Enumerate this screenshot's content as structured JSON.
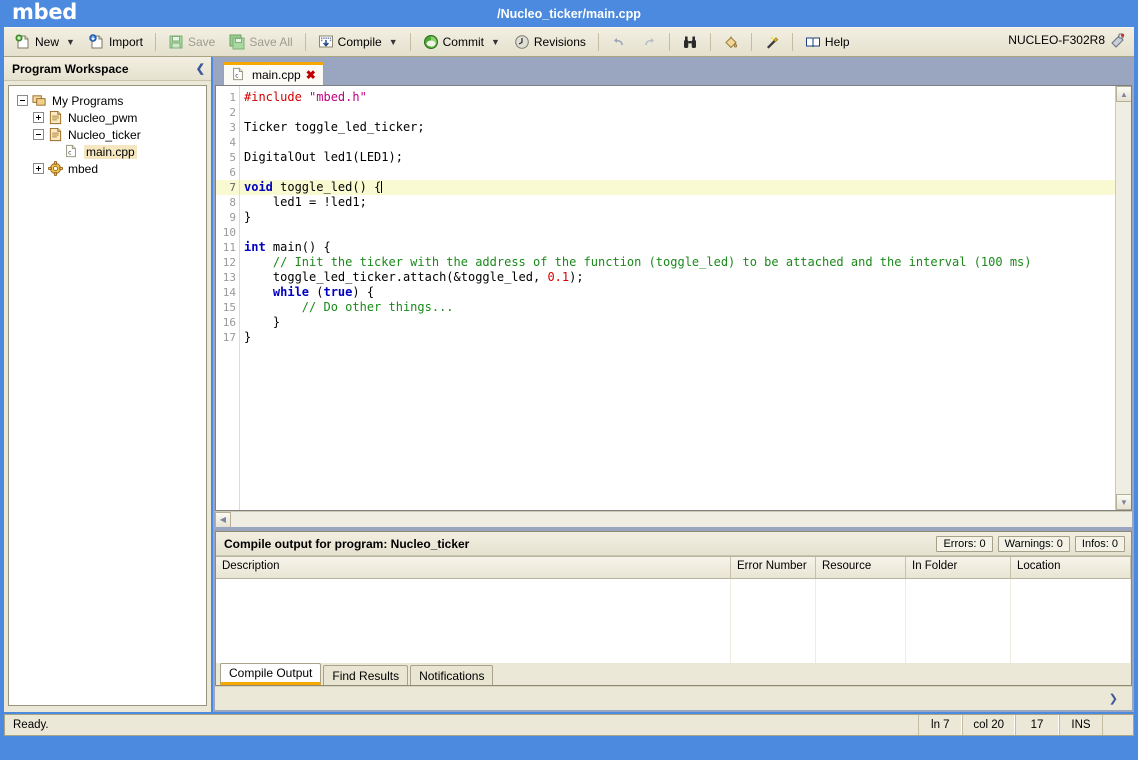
{
  "window": {
    "brand": "mbed",
    "title": "/Nucleo_ticker/main.cpp"
  },
  "toolbar": {
    "new_label": "New",
    "import_label": "Import",
    "save_label": "Save",
    "save_all_label": "Save All",
    "compile_label": "Compile",
    "commit_label": "Commit",
    "revisions_label": "Revisions",
    "help_label": "Help",
    "device_label": "NUCLEO-F302R8"
  },
  "sidebar": {
    "title": "Program Workspace",
    "tree": [
      {
        "label": "My Programs",
        "indent": 0,
        "state": "minus",
        "icon": "programs-icon",
        "selected": false
      },
      {
        "label": "Nucleo_pwm",
        "indent": 1,
        "state": "plus",
        "icon": "program-icon",
        "selected": false
      },
      {
        "label": "Nucleo_ticker",
        "indent": 1,
        "state": "minus",
        "icon": "program-icon",
        "selected": false
      },
      {
        "label": "main.cpp",
        "indent": 2,
        "state": "none",
        "icon": "cfile-icon",
        "selected": true
      },
      {
        "label": "mbed",
        "indent": 1,
        "state": "plus",
        "icon": "library-icon",
        "selected": false
      }
    ]
  },
  "editor": {
    "tab_label": "main.cpp",
    "tab_close": "✖",
    "current_line": 7,
    "line_numbers": [
      "1",
      "2",
      "3",
      "4",
      "5",
      "6",
      "7",
      "8",
      "9",
      "10",
      "11",
      "12",
      "13",
      "14",
      "15",
      "16",
      "17"
    ],
    "code": [
      "#include \"mbed.h\"",
      "",
      "Ticker toggle_led_ticker;",
      "",
      "DigitalOut led1(LED1);",
      "",
      "void toggle_led() {",
      "    led1 = !led1;",
      "}",
      "",
      "int main() {",
      "    // Init the ticker with the address of the function (toggle_led) to be attached and the interval (100 ms)",
      "    toggle_led_ticker.attach(&toggle_led, 0.1);",
      "    while (true) {",
      "        // Do other things...",
      "    }",
      "}"
    ]
  },
  "compile_output": {
    "header": "Compile output for program: Nucleo_ticker",
    "errors_label": "Errors: 0",
    "warnings_label": "Warnings: 0",
    "infos_label": "Infos: 0",
    "columns": [
      "Description",
      "Error Number",
      "Resource",
      "In Folder",
      "Location"
    ],
    "rows": [],
    "tabs": [
      {
        "label": "Compile Output",
        "active": true
      },
      {
        "label": "Find Results",
        "active": false
      },
      {
        "label": "Notifications",
        "active": false
      }
    ]
  },
  "statusbar": {
    "message": "Ready.",
    "line": "ln 7",
    "col": "col 20",
    "total": "17",
    "mode": "INS"
  },
  "colors": {
    "title_bar": "#4b8ade",
    "toolbar": "#ece8d8",
    "accent": "#f7a800",
    "selection": "#f5e7bf"
  }
}
